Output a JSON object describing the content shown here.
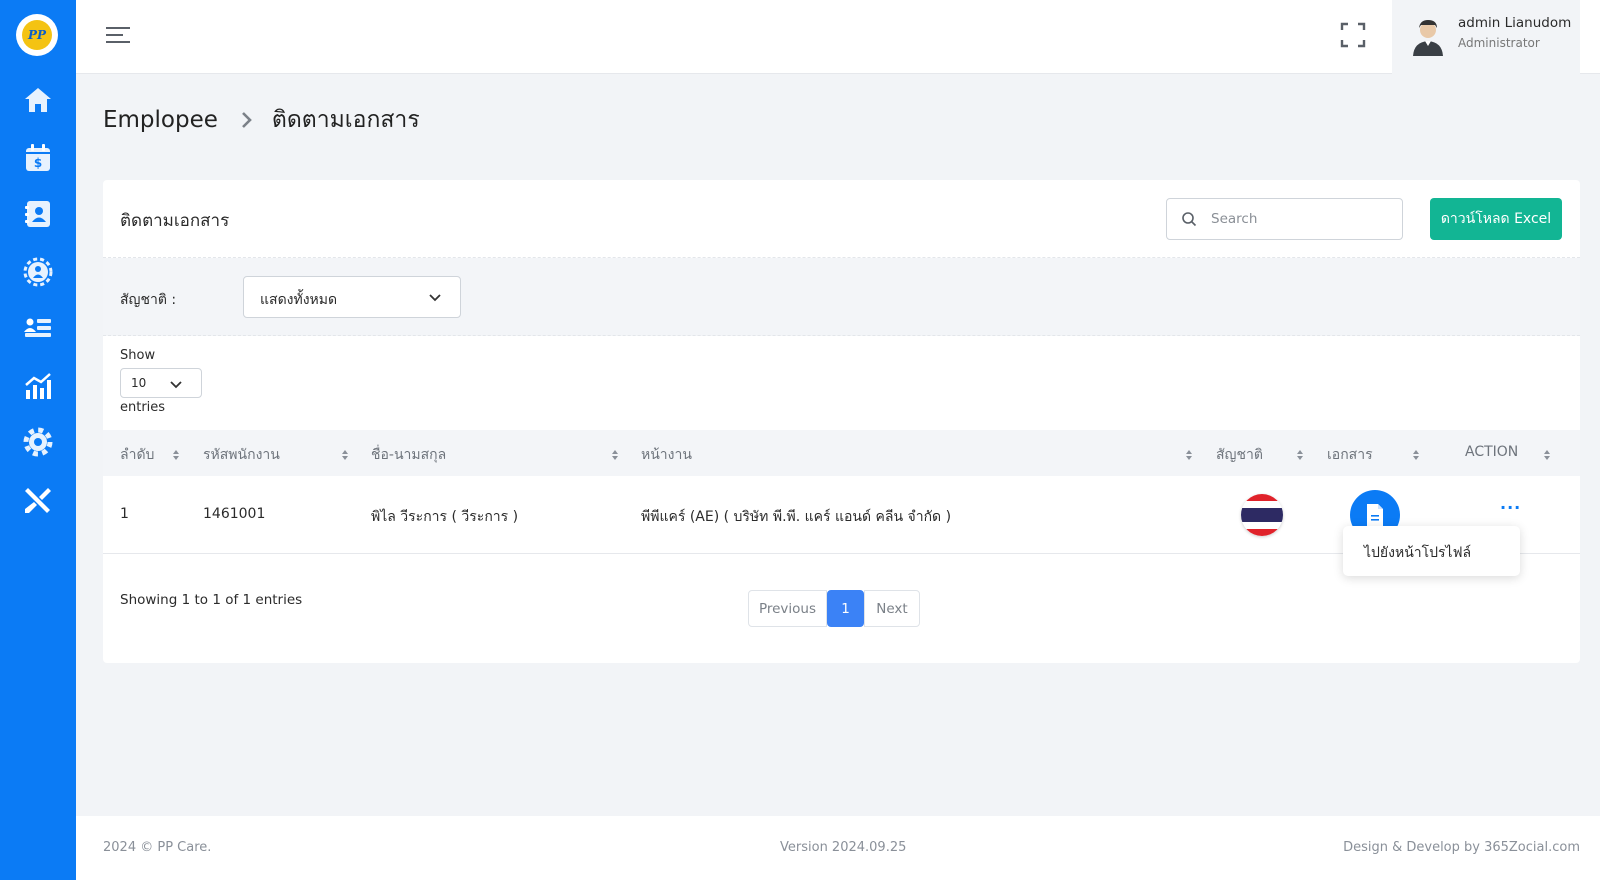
{
  "app": {
    "logo_text": "PP",
    "accent_color": "#0b7bf5",
    "success_color": "#12b594"
  },
  "sidebar": {
    "items": [
      {
        "icon": "home-icon",
        "name": "sidebar-item-home"
      },
      {
        "icon": "calendar-dollar-icon",
        "name": "sidebar-item-payroll"
      },
      {
        "icon": "contact-card-icon",
        "name": "sidebar-item-employee"
      },
      {
        "icon": "team-gear-icon",
        "name": "sidebar-item-team"
      },
      {
        "icon": "user-list-icon",
        "name": "sidebar-item-list"
      },
      {
        "icon": "bar-chart-icon",
        "name": "sidebar-item-report"
      },
      {
        "icon": "gear-icon",
        "name": "sidebar-item-settings"
      },
      {
        "icon": "tools-icon",
        "name": "sidebar-item-tools"
      }
    ]
  },
  "topbar": {
    "user_name": "admin Lianudom",
    "user_role": "Administrator"
  },
  "breadcrumb": {
    "parent": "Emplopee",
    "current": "ติดตามเอกสาร"
  },
  "card": {
    "title": "ติดตามเอกสาร",
    "search_placeholder": "Search",
    "excel_button": "ดาวน์โหลด Excel"
  },
  "filter": {
    "label": "สัญชาติ :",
    "selected": "แสดงทั้งหมด"
  },
  "length": {
    "show_label": "Show",
    "value": "10",
    "entries_label": "entries"
  },
  "table": {
    "headers": [
      "ลำดับ",
      "รหัสพนักงาน",
      "ชื่อ-นามสกุล",
      "หน้างาน",
      "สัญชาติ",
      "เอกสาร",
      "ACTION"
    ],
    "rows": [
      {
        "no": "1",
        "code": "1461001",
        "name": "พิไล วีระการ ( วีระการ )",
        "site": "พีพีแคร์ (AE) ( บริษัท พี.พี. แคร์ แอนด์ คลีน จำกัด )",
        "nationality_icon": "thailand-flag-icon",
        "action_label": "···"
      }
    ]
  },
  "action_menu": {
    "item": "ไปยังหน้าโปรไฟล์"
  },
  "pagination": {
    "info": "Showing 1 to 1 of 1 entries",
    "previous": "Previous",
    "current": "1",
    "next": "Next"
  },
  "footer": {
    "copyright": "2024 © PP Care.",
    "version": "Version 2024.09.25",
    "credit": "Design & Develop by 365Zocial.com"
  }
}
